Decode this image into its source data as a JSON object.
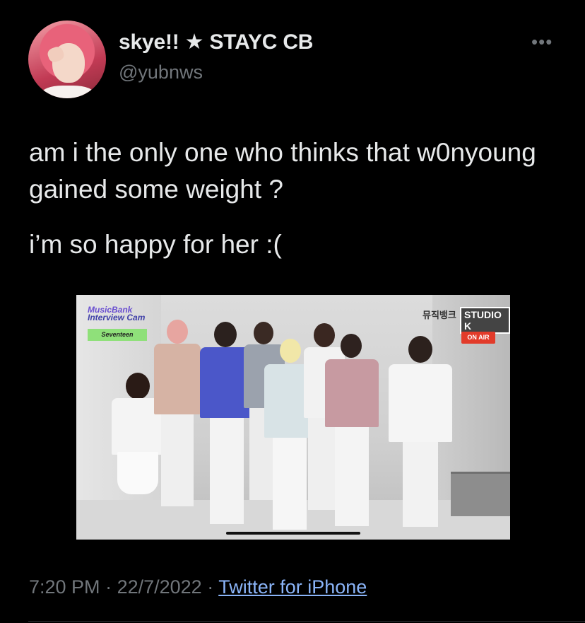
{
  "author": {
    "display_name": "skye!! ★ STAYC CB",
    "handle": "@yubnws"
  },
  "menu": {
    "more_label": "•••"
  },
  "tweet": {
    "paragraphs": [
      "am i the only one who thinks that w0nyoung gained some weight ?",
      "i’m so happy for her :("
    ]
  },
  "media": {
    "overlay": {
      "music_bank_line1": "MusicBank",
      "music_bank_line2": "Interview Cam",
      "group_tag": "Seventeen",
      "show_logo": "뮤직뱅크",
      "studio_logo": "STUDIO K",
      "on_air": "ON AIR"
    }
  },
  "meta": {
    "time": "7:20 PM",
    "date": "22/7/2022",
    "separator": " · ",
    "source": "Twitter for iPhone"
  }
}
